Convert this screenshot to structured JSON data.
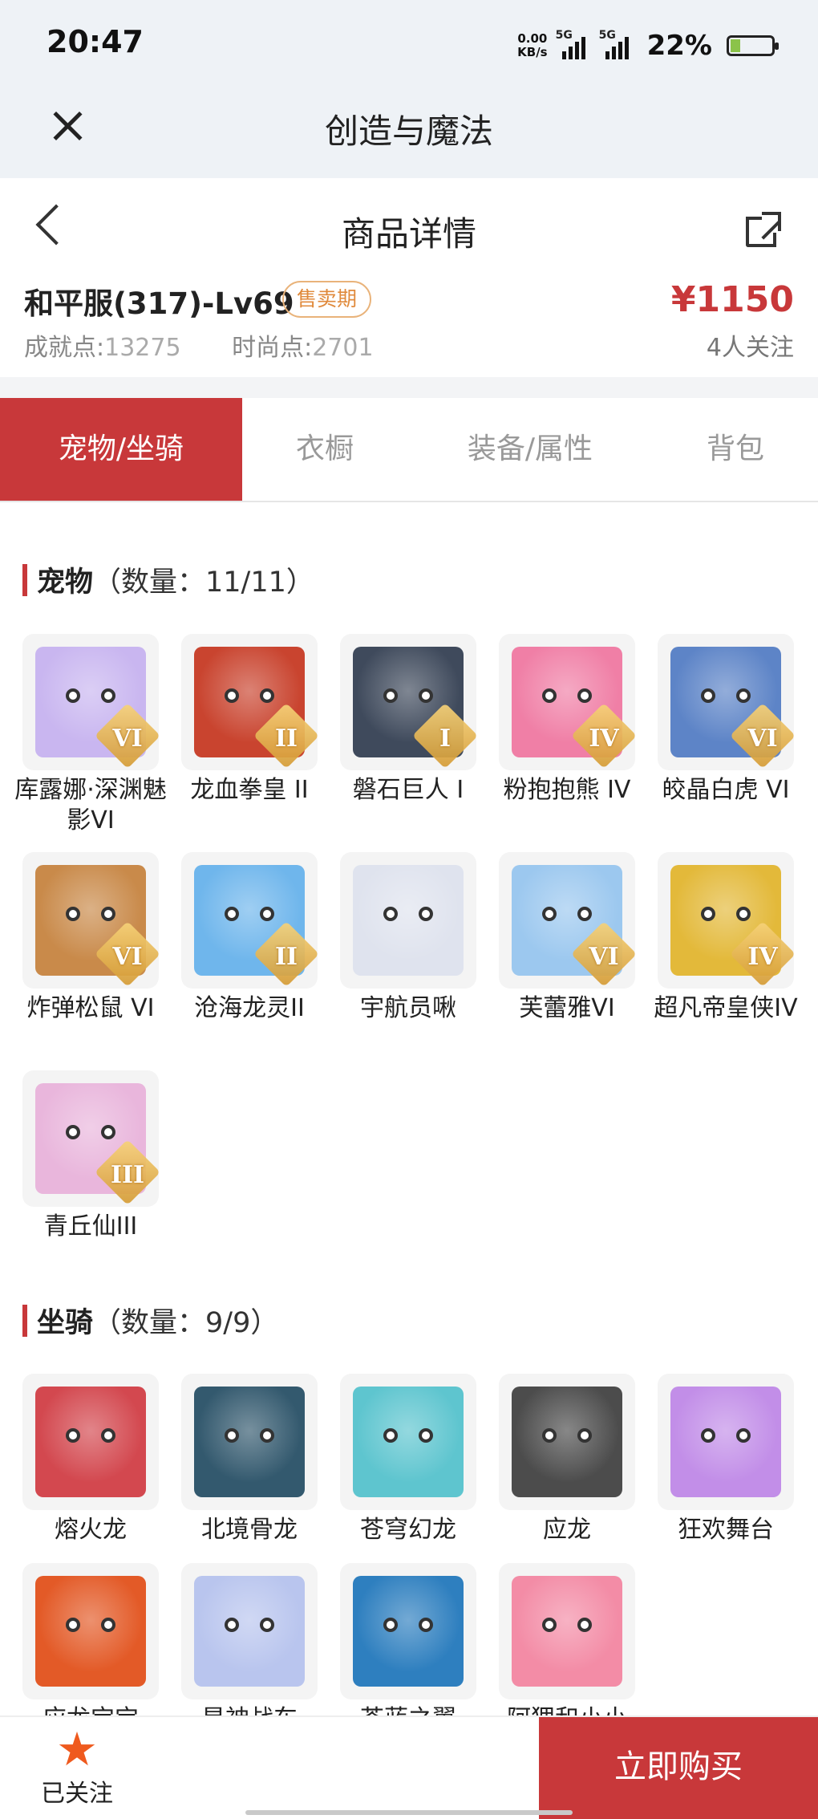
{
  "status": {
    "time": "20:47",
    "net_speed_top": "0.00",
    "net_speed_unit": "KB/s",
    "sim1": "5G",
    "sim2": "5G",
    "battery": "22%"
  },
  "app": {
    "title": "创造与魔法"
  },
  "page": {
    "title": "商品详情"
  },
  "product": {
    "name": "和平服(317)-Lv69",
    "badge": "售卖期",
    "achievement_label": "成就点:",
    "achievement_value": "13275",
    "fashion_label": "时尚点:",
    "fashion_value": "2701",
    "price": "¥1150",
    "followers": "4人关注"
  },
  "tabs": [
    "宠物/坐骑",
    "衣橱",
    "装备/属性",
    "背包"
  ],
  "pets": {
    "title": "宠物",
    "count": "（数量：11/11）",
    "items": [
      {
        "name": "库露娜·深渊魅影VI",
        "rank": "VI",
        "color": "#c9b6f0"
      },
      {
        "name": "龙血拳皇 II",
        "rank": "II",
        "color": "#c9442f"
      },
      {
        "name": "磐石巨人 I",
        "rank": "I",
        "color": "#3f4a5c"
      },
      {
        "name": "粉抱抱熊 IV",
        "rank": "IV",
        "color": "#f07fa6"
      },
      {
        "name": "皎晶白虎 VI",
        "rank": "VI",
        "color": "#5d84c7"
      },
      {
        "name": "炸弹松鼠 VI",
        "rank": "VI",
        "color": "#c98a4a"
      },
      {
        "name": "沧海龙灵II",
        "rank": "II",
        "color": "#6fb6ec"
      },
      {
        "name": "宇航员啾",
        "rank": "",
        "color": "#dfe3ee"
      },
      {
        "name": "芙蕾雅VI",
        "rank": "VI",
        "color": "#9cc8ef"
      },
      {
        "name": "超凡帝皇侠IV",
        "rank": "IV",
        "color": "#e3b93a"
      },
      {
        "name": "青丘仙III",
        "rank": "III",
        "color": "#e9b6dc"
      }
    ]
  },
  "mounts": {
    "title": "坐骑",
    "count": "（数量：9/9）",
    "items": [
      {
        "name": "熔火龙",
        "color": "#d3484f"
      },
      {
        "name": "北境骨龙",
        "color": "#33596e"
      },
      {
        "name": "苍穹幻龙",
        "color": "#5ec5cf"
      },
      {
        "name": "应龙",
        "color": "#4c4c4c"
      },
      {
        "name": "狂欢舞台",
        "color": "#c28ee8"
      },
      {
        "name": "应龙宝宝",
        "color": "#e35a27"
      },
      {
        "name": "星神战车",
        "color": "#b9c5ee"
      },
      {
        "name": "苍蓝之翼",
        "color": "#2e7fbf"
      },
      {
        "name": "阿狸和小小",
        "color": "#f38ca6"
      }
    ]
  },
  "bottom": {
    "follow_label": "已关注",
    "buy_label": "立即购买"
  }
}
